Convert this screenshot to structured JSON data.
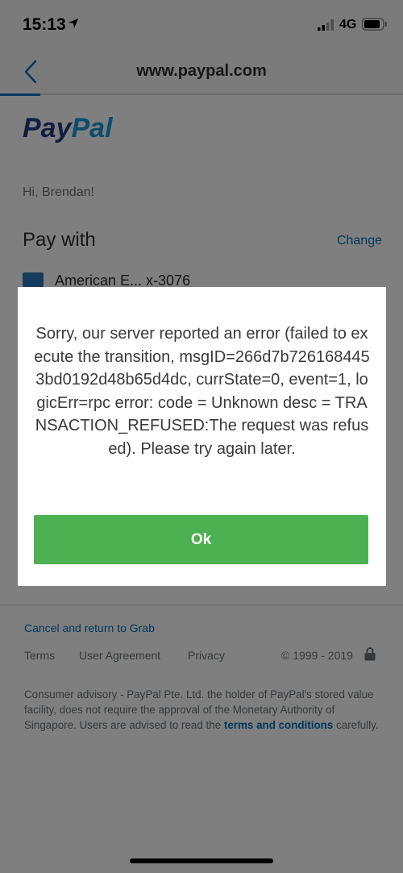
{
  "status_bar": {
    "time": "15:13",
    "network": "4G",
    "icons": [
      "location-arrow-icon",
      "signal-icon",
      "battery-icon"
    ]
  },
  "nav": {
    "title": "www.paypal.com",
    "back_icon": "chevron-left-icon"
  },
  "page": {
    "logo_part1": "Pay",
    "logo_part2": "Pal",
    "greeting": "Hi, Brendan!",
    "pay_with": "Pay with",
    "change": "Change",
    "card_label": "American E...    x-3076",
    "cancel_link": "Cancel and return to Grab",
    "footer_links": {
      "terms": "Terms",
      "user_agreement": "User Agreement",
      "privacy": "Privacy",
      "copyright": "© 1999 - 2019"
    },
    "advisory_text": "Consumer advisory - PayPal Pte. Ltd. the holder of PayPal's stored value facility, does not require the approval of the Monetary Authority of Singapore. Users are advised to read the ",
    "advisory_link": "terms and conditions",
    "advisory_end": " carefully."
  },
  "modal": {
    "message": "Sorry, our server reported an error (failed to execute the transition, msgID=266d7b7261684453bd0192d48b65d4dc, currState=0, event=1, logicErr=rpc error: code = Unknown desc = TRANSACTION_REFUSED:The request was refused). Please try again later.",
    "ok_label": "Ok"
  },
  "colors": {
    "ok_button": "#4caf50",
    "link": "#0070ba",
    "overlay": "rgba(0,0,0,0.5)"
  }
}
